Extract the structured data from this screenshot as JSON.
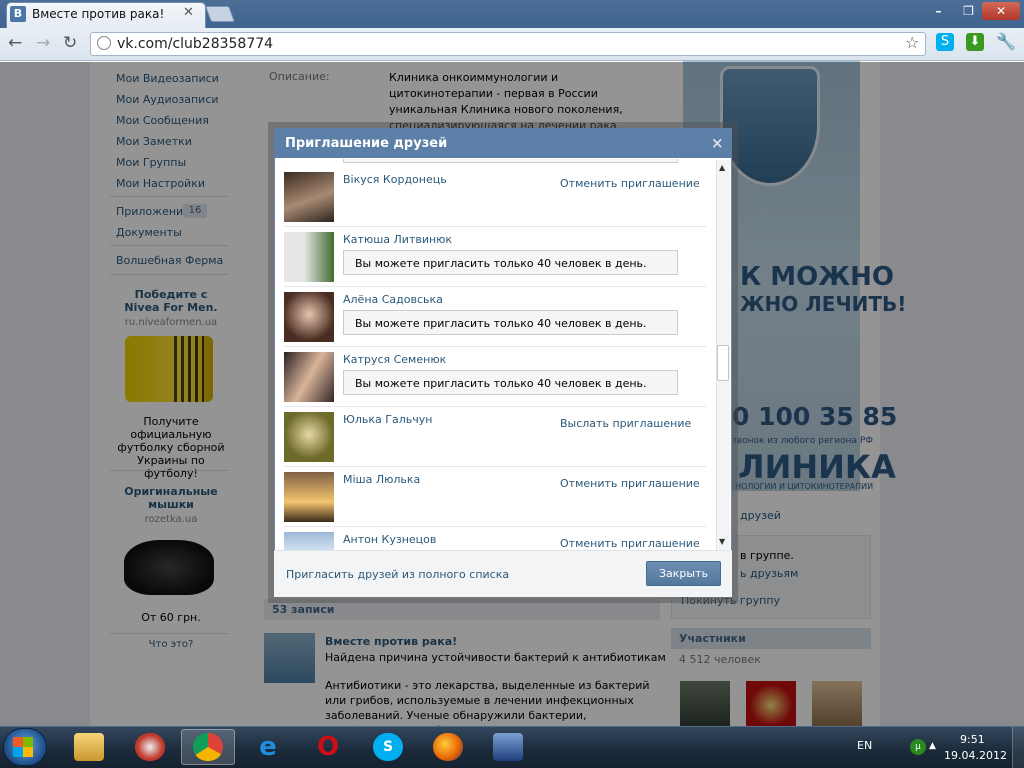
{
  "browser": {
    "tab_title": "Вместе против рака!",
    "tab_favicon": "В",
    "url": "vk.com/club28358774",
    "icons": [
      "back-icon",
      "forward-icon",
      "reload-icon",
      "star-icon",
      "skype-icon",
      "download-icon",
      "wrench-icon"
    ]
  },
  "left_menu": {
    "items": [
      "Мои Видеозаписи",
      "Мои Аудиозаписи",
      "Мои Сообщения",
      "Мои Заметки",
      "Мои Группы",
      "Мои Настройки"
    ],
    "apps_label": "Приложения",
    "apps_count": "16",
    "docs_label": "Документы",
    "farm_label": "Волшебная Ферма"
  },
  "ads": [
    {
      "title": "Победите с Nivea For Men.",
      "site": "ru.niveaformen.ua",
      "text": "Получите официальную футболку сборной Украины по футболу!"
    },
    {
      "title": "Оригинальные мышки",
      "site": "rozetka.ua",
      "text": "От 60 грн."
    }
  ],
  "ads_what": "Что это?",
  "group": {
    "desc_label": "Описание:",
    "desc_text": "Клиника онкоиммунологии и цитокинотерапии - первая в России уникальная Клиника нового поколения, специализирующаяся на лечении рака. Нашим пациентам теперь доступны самые"
  },
  "banner": {
    "can": "К МОЖНО",
    "cure": "ЖНО ЛЕЧИТЬ!",
    "phone": "0 100 35 85",
    "call": "звонок из любого региона РФ",
    "clinic": "ЛИНИКА",
    "sub": "НОЛОГИИ И ЦИТОКИНОТЕРАПИИ"
  },
  "right": {
    "friends_link": "друзей",
    "in_group": "в группе.",
    "to_friends": "ь друзьям",
    "leave": "Покинуть группу",
    "members_title": "Участники",
    "members_count": "4 512 человек"
  },
  "wall": {
    "posts_count": "53 записи",
    "author": "Вместе против рака!",
    "headline": "Найдена причина устойчивости бактерий к антибиотикам",
    "body": "Антибиотики - это лекарства, выделенные из бактерий или грибов, используемые в лечении инфекционных заболеваний. Ученые обнаружили бактерии, устойчивые к антибиотикам. Почему это открытие так важно и актуально читайте далее"
  },
  "modal": {
    "title": "Приглашение друзей",
    "close_x": "×",
    "limit_text": "Вы можете пригласить только 40 человек в день.",
    "friends": [
      {
        "name": "Вікуся Кордонець",
        "action": "Отменить приглашение",
        "state": "action"
      },
      {
        "name": "Катюша Литвинюк",
        "action": "",
        "state": "limit"
      },
      {
        "name": "Алёна Садовська",
        "action": "",
        "state": "limit"
      },
      {
        "name": "Катруся Семенюк",
        "action": "",
        "state": "limit"
      },
      {
        "name": "Юлька Гальчун",
        "action": "Выслать приглашение",
        "state": "action"
      },
      {
        "name": "Міша Люлька",
        "action": "Отменить приглашение",
        "state": "action"
      },
      {
        "name": "Антон Кузнецов",
        "action": "Отменить приглашение",
        "state": "action"
      }
    ],
    "invite_all": "Пригласить друзей из полного списка",
    "close_button": "Закрыть"
  },
  "taskbar": {
    "lang": "EN",
    "time": "9:51",
    "date": "19.04.2012",
    "apps": [
      "explorer-icon",
      "app-icon",
      "chrome-icon",
      "ie-icon",
      "opera-icon",
      "skype-icon",
      "firefox-icon",
      "app-icon"
    ]
  }
}
